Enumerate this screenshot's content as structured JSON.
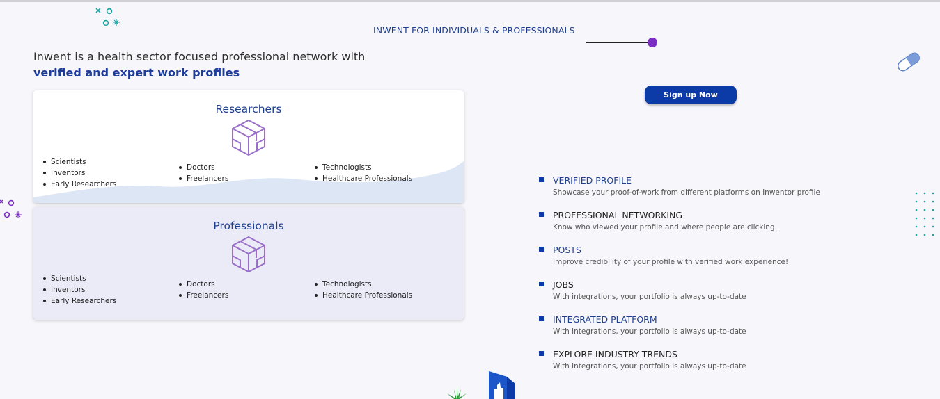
{
  "header": {
    "section_tag": "INWENT FOR INDIVIDUALS & PROFESSIONALS"
  },
  "intro": {
    "line1": "Inwent is a health sector focused professional network with",
    "line2": "verified and expert work profiles"
  },
  "cards": [
    {
      "title": "Researchers",
      "columns": [
        [
          "Scientists",
          "Inventors",
          "Early Researchers"
        ],
        [
          "Doctors",
          "Freelancers"
        ],
        [
          "Technologists",
          "Healthcare Professionals"
        ]
      ]
    },
    {
      "title": "Professionals",
      "columns": [
        [
          "Scientists",
          "Inventors",
          "Early Researchers"
        ],
        [
          "Doctors",
          "Freelancers"
        ],
        [
          "Technologists",
          "Healthcare Professionals"
        ]
      ]
    }
  ],
  "cta": {
    "signup_label": "Sign up Now"
  },
  "features": [
    {
      "title": "VERIFIED PROFILE",
      "desc": "Showcase your proof-of-work from different platforms on Inwentor profile"
    },
    {
      "title": "PROFESSIONAL NETWORKING",
      "desc": "Know who viewed your profile and where people are clicking."
    },
    {
      "title": "POSTS",
      "desc": "Improve credibility of your profile with verified work experience!"
    },
    {
      "title": "JOBS",
      "desc": "With integrations, your portfolio is always up-to-date"
    },
    {
      "title": "INTEGRATED PLATFORM",
      "desc": "With integrations, your portfolio is always up-to-date"
    },
    {
      "title": "EXPLORE INDUSTRY TRENDS",
      "desc": "With integrations, your portfolio is always up-to-date"
    }
  ],
  "colors": {
    "brand": "#0c3aa6",
    "accent_purple": "#7b2ec2",
    "heading_blue": "#1e3e8f"
  },
  "icons": [
    "sparkle-icon",
    "cube-icon",
    "pill-icon",
    "thumbs-up-icon",
    "plant-icon",
    "dot-grid-icon"
  ]
}
